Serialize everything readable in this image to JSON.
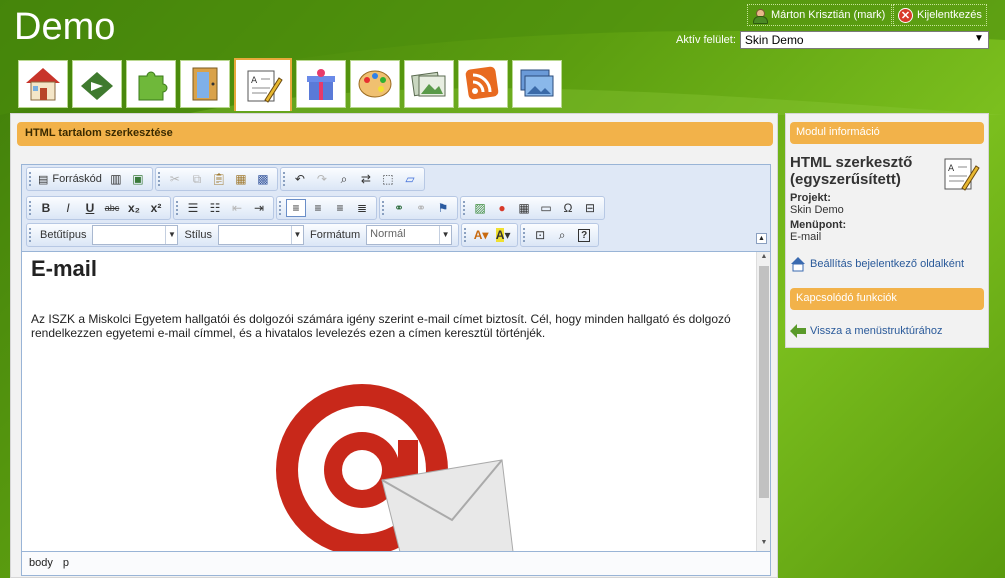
{
  "app": {
    "title": "Demo"
  },
  "header": {
    "user_name": "Márton Krisztián (mark)",
    "logout_label": "Kijelentkezés",
    "skin_label": "Aktív felület:",
    "skin_value": "Skin Demo"
  },
  "tabs": [
    {
      "icon": "home-icon"
    },
    {
      "icon": "download-arrow-icon"
    },
    {
      "icon": "puzzle-icon"
    },
    {
      "icon": "door-icon"
    },
    {
      "icon": "html-edit-icon",
      "active": true
    },
    {
      "icon": "gift-icon"
    },
    {
      "icon": "palette-icon"
    },
    {
      "icon": "gallery-icon"
    },
    {
      "icon": "rss-light-icon"
    },
    {
      "icon": "slideshow-icon"
    }
  ],
  "main": {
    "panel_title": "HTML tartalom szerkesztése",
    "toolbar": {
      "source_label": "Forráskód",
      "font_label": "Betűtípus",
      "style_label": "Stílus",
      "format_label": "Formátum",
      "format_value": "Normál"
    },
    "document": {
      "heading": "E-mail",
      "paragraph": "Az ISZK a Miskolci Egyetem hallgatói és dolgozói számára igény szerint e-mail címet biztosít. Cél, hogy minden hallgató és dolgozó rendelkezzen egyetemi e-mail címmel, és a hivatalos levelezés ezen a címen keresztül történjék."
    },
    "statusbar": {
      "path1": "body",
      "path2": "p"
    }
  },
  "sidebar": {
    "module_header": "Modul információ",
    "module_name": "HTML szerkesztő (egyszerűsített)",
    "project_label": "Projekt:",
    "project_value": "Skin Demo",
    "menu_label": "Menüpont:",
    "menu_value": "E-mail",
    "login_link": "Beállítás bejelentkező oldalként",
    "related_header": "Kapcsolódó funkciók",
    "back_link": "Vissza a menüstruktúrához"
  },
  "colors": {
    "accent": "#f2b24a",
    "green": "#5c9e10",
    "editor_border": "#99b4d6"
  }
}
